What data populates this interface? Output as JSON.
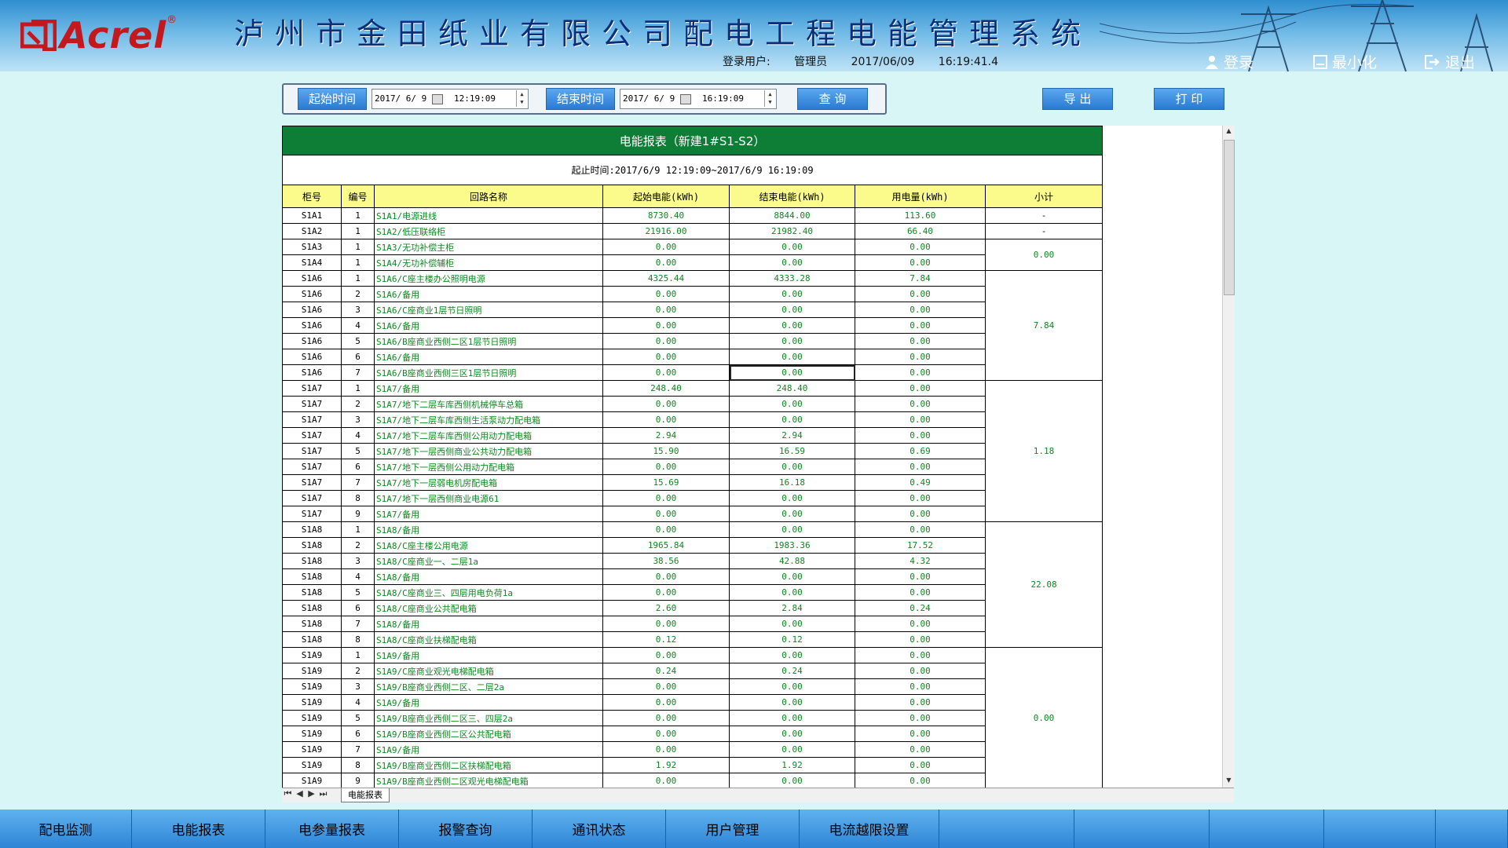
{
  "header": {
    "brand": "Acrel",
    "title": "泸州市金田纸业有限公司配电工程电能管理系统",
    "login_user_label": "登录用户:",
    "login_user": "管理员",
    "date": "2017/06/09",
    "time": "16:19:41.4",
    "login_label": "登录",
    "minimize_label": "最小化",
    "exit_label": "退出"
  },
  "toolbar": {
    "start_label": "起始时间",
    "start_date": "2017/ 6/ 9",
    "start_time": "12:19:09",
    "end_label": "结束时间",
    "end_date": "2017/ 6/ 9",
    "end_time": "16:19:09",
    "query_label": "查 询",
    "export_label": "导 出",
    "print_label": "打 印"
  },
  "report": {
    "title": "电能报表（新建1#S1-S2）",
    "range": "起止时间:2017/6/9 12:19:09~2017/6/9 16:19:09",
    "columns": [
      "柜号",
      "编号",
      "回路名称",
      "起始电能(kWh)",
      "结束电能(kWh)",
      "用电量(kWh)",
      "小计"
    ],
    "rows": [
      [
        "S1A1",
        "1",
        "S1A1/电源进线",
        "8730.40",
        "8844.00",
        "113.60"
      ],
      [
        "S1A2",
        "1",
        "S1A2/低压联络柜",
        "21916.00",
        "21982.40",
        "66.40"
      ],
      [
        "S1A3",
        "1",
        "S1A3/无功补偿主柜",
        "0.00",
        "0.00",
        "0.00"
      ],
      [
        "S1A4",
        "1",
        "S1A4/无功补偿辅柜",
        "0.00",
        "0.00",
        "0.00"
      ],
      [
        "S1A6",
        "1",
        "S1A6/C座主楼办公照明电源",
        "4325.44",
        "4333.28",
        "7.84"
      ],
      [
        "S1A6",
        "2",
        "S1A6/备用",
        "0.00",
        "0.00",
        "0.00"
      ],
      [
        "S1A6",
        "3",
        "S1A6/C座商业1层节日照明",
        "0.00",
        "0.00",
        "0.00"
      ],
      [
        "S1A6",
        "4",
        "S1A6/备用",
        "0.00",
        "0.00",
        "0.00"
      ],
      [
        "S1A6",
        "5",
        "S1A6/B座商业西侧二区1层节日照明",
        "0.00",
        "0.00",
        "0.00"
      ],
      [
        "S1A6",
        "6",
        "S1A6/备用",
        "0.00",
        "0.00",
        "0.00"
      ],
      [
        "S1A6",
        "7",
        "S1A6/B座商业西侧三区1层节日照明",
        "0.00",
        "0.00",
        "0.00"
      ],
      [
        "S1A7",
        "1",
        "S1A7/备用",
        "248.40",
        "248.40",
        "0.00"
      ],
      [
        "S1A7",
        "2",
        "S1A7/地下二层车库西侧机械停车总箱",
        "0.00",
        "0.00",
        "0.00"
      ],
      [
        "S1A7",
        "3",
        "S1A7/地下二层车库西侧生活泵动力配电箱",
        "0.00",
        "0.00",
        "0.00"
      ],
      [
        "S1A7",
        "4",
        "S1A7/地下二层车库西侧公用动力配电箱",
        "2.94",
        "2.94",
        "0.00"
      ],
      [
        "S1A7",
        "5",
        "S1A7/地下一层西侧商业公共动力配电箱",
        "15.90",
        "16.59",
        "0.69"
      ],
      [
        "S1A7",
        "6",
        "S1A7/地下一层西侧公用动力配电箱",
        "0.00",
        "0.00",
        "0.00"
      ],
      [
        "S1A7",
        "7",
        "S1A7/地下一层弱电机房配电箱",
        "15.69",
        "16.18",
        "0.49"
      ],
      [
        "S1A7",
        "8",
        "S1A7/地下一层西侧商业电源61",
        "0.00",
        "0.00",
        "0.00"
      ],
      [
        "S1A7",
        "9",
        "S1A7/备用",
        "0.00",
        "0.00",
        "0.00"
      ],
      [
        "S1A8",
        "1",
        "S1A8/备用",
        "0.00",
        "0.00",
        "0.00"
      ],
      [
        "S1A8",
        "2",
        "S1A8/C座主楼公用电源",
        "1965.84",
        "1983.36",
        "17.52"
      ],
      [
        "S1A8",
        "3",
        "S1A8/C座商业一、二层1a",
        "38.56",
        "42.88",
        "4.32"
      ],
      [
        "S1A8",
        "4",
        "S1A8/备用",
        "0.00",
        "0.00",
        "0.00"
      ],
      [
        "S1A8",
        "5",
        "S1A8/C座商业三、四层用电负荷1a",
        "0.00",
        "0.00",
        "0.00"
      ],
      [
        "S1A8",
        "6",
        "S1A8/C座商业公共配电箱",
        "2.60",
        "2.84",
        "0.24"
      ],
      [
        "S1A8",
        "7",
        "S1A8/备用",
        "0.00",
        "0.00",
        "0.00"
      ],
      [
        "S1A8",
        "8",
        "S1A8/C座商业扶梯配电箱",
        "0.12",
        "0.12",
        "0.00"
      ],
      [
        "S1A9",
        "1",
        "S1A9/备用",
        "0.00",
        "0.00",
        "0.00"
      ],
      [
        "S1A9",
        "2",
        "S1A9/C座商业观光电梯配电箱",
        "0.24",
        "0.24",
        "0.00"
      ],
      [
        "S1A9",
        "3",
        "S1A9/B座商业西侧二区、二层2a",
        "0.00",
        "0.00",
        "0.00"
      ],
      [
        "S1A9",
        "4",
        "S1A9/备用",
        "0.00",
        "0.00",
        "0.00"
      ],
      [
        "S1A9",
        "5",
        "S1A9/B座商业西侧二区三、四层2a",
        "0.00",
        "0.00",
        "0.00"
      ],
      [
        "S1A9",
        "6",
        "S1A9/B座商业西侧二区公共配电箱",
        "0.00",
        "0.00",
        "0.00"
      ],
      [
        "S1A9",
        "7",
        "S1A9/备用",
        "0.00",
        "0.00",
        "0.00"
      ],
      [
        "S1A9",
        "8",
        "S1A9/B座商业西侧二区扶梯配电箱",
        "1.92",
        "1.92",
        "0.00"
      ],
      [
        "S1A9",
        "9",
        "S1A9/B座商业西侧二区观光电梯配电箱",
        "0.00",
        "0.00",
        "0.00"
      ]
    ],
    "subtotals": [
      {
        "value": "-",
        "span": 1
      },
      {
        "value": "-",
        "span": 1
      },
      {
        "value": "0.00",
        "span": 2
      },
      {
        "value": "7.84",
        "span": 7
      },
      {
        "value": "1.18",
        "span": 9
      },
      {
        "value": "22.08",
        "span": 8
      },
      {
        "value": "0.00",
        "span": 9
      }
    ],
    "sheet_tab": "电能报表"
  },
  "bottom_nav": [
    "配电监测",
    "电能报表",
    "电参量报表",
    "报警查询",
    "通讯状态",
    "用户管理",
    "电流越限设置",
    "",
    "",
    "",
    "",
    ""
  ],
  "colors": {
    "title_green": "#0e7d36",
    "header_yellow": "#fbfb8c",
    "value_green": "#0c8a1f",
    "brand_red": "#c3181e"
  }
}
